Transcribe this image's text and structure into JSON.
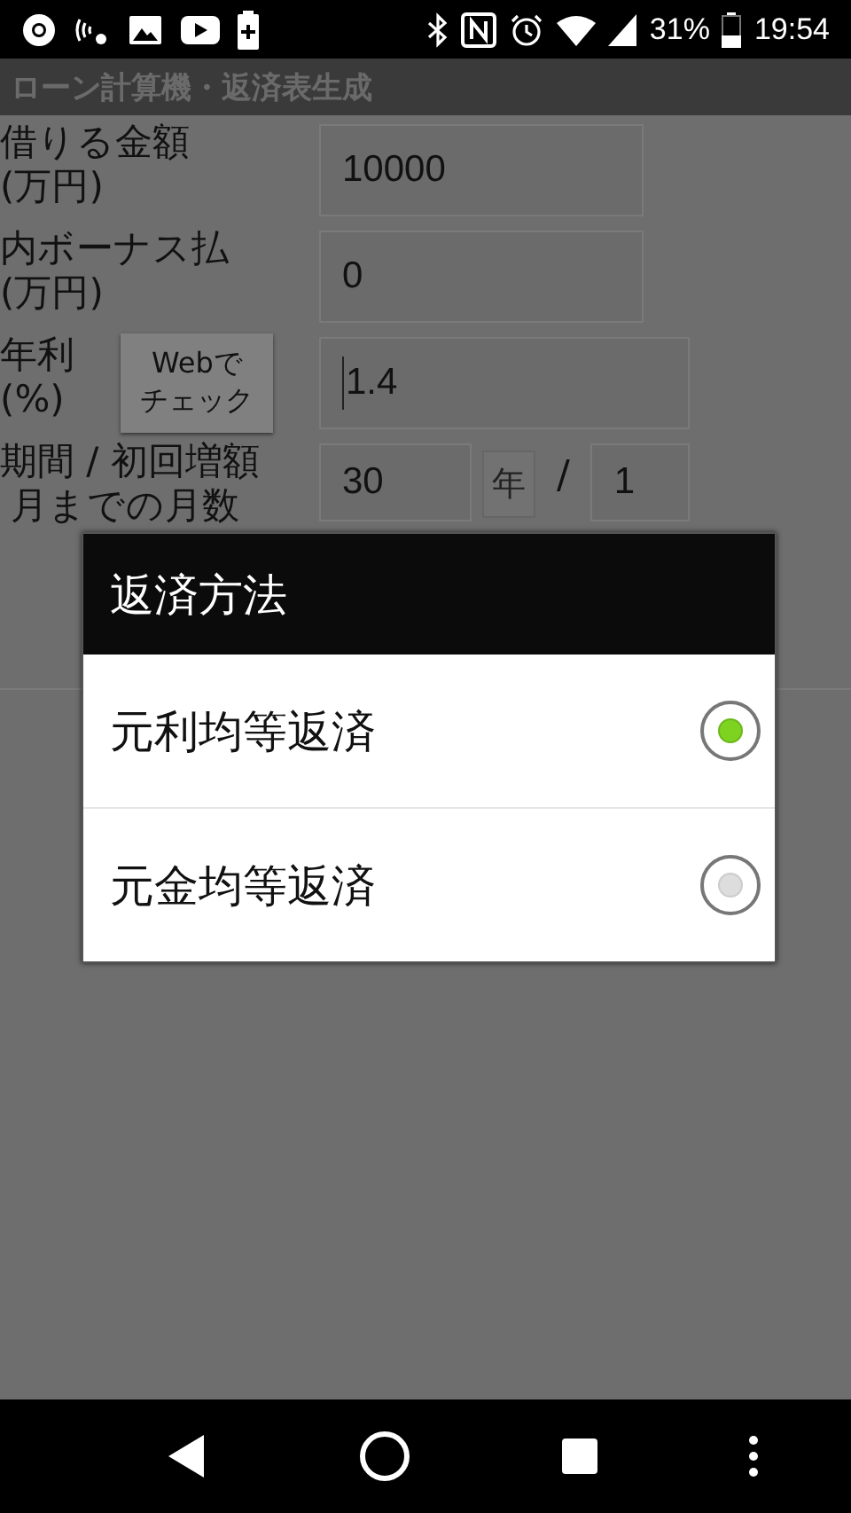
{
  "status_bar": {
    "battery": "31%",
    "time": "19:54"
  },
  "app_title": "ローン計算機・返済表生成",
  "form": {
    "rows": [
      {
        "kind": "field",
        "label_lines": [
          "借りる金額",
          "(万円)"
        ],
        "value": "10000"
      },
      {
        "kind": "field",
        "label_lines": [
          "内ボーナス払",
          "(万円)"
        ],
        "value": "0"
      },
      {
        "kind": "web",
        "label_lines": [
          "年利",
          "(%)"
        ],
        "button_lines": [
          "Webで",
          "チェック"
        ],
        "value": "1.4"
      },
      {
        "kind": "period",
        "label_lines": [
          "期間 / 初回増額",
          "月までの月数"
        ],
        "value": "30",
        "unit": "年",
        "separator": "/",
        "value2": "1"
      }
    ]
  },
  "dialog": {
    "title": "返済方法",
    "options": [
      {
        "label": "元利均等返済",
        "selected": true
      },
      {
        "label": "元金均等返済",
        "selected": false
      }
    ]
  }
}
